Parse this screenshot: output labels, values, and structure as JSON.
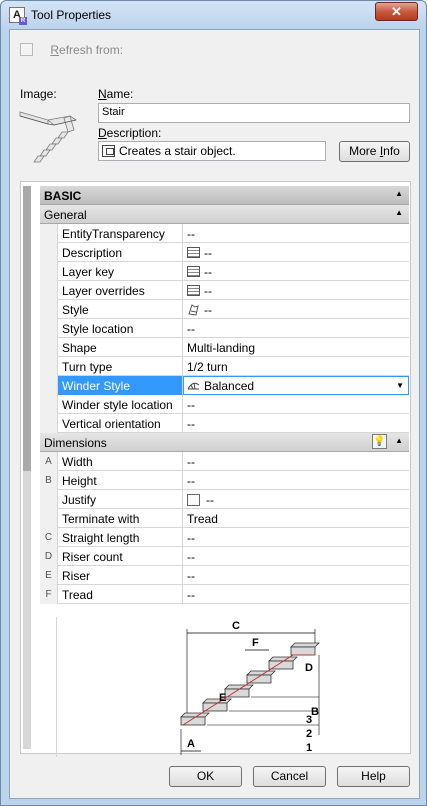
{
  "window": {
    "title": "Tool Properties",
    "close_label": "✕"
  },
  "header": {
    "refresh_label_prefix": "R",
    "refresh_label_rest": "efresh from:",
    "image_label": "Image:",
    "name_label_prefix": "N",
    "name_label_rest": "ame:",
    "name_value": "Stair",
    "description_label_prefix": "D",
    "description_label_rest": "escription:",
    "description_value": "Creates a stair object.",
    "more_info_prefix": "More ",
    "more_info_underlined": "I",
    "more_info_rest": "nfo"
  },
  "grid": {
    "basic_label": "BASIC",
    "general_label": "General",
    "dimensions_label": "Dimensions",
    "general_rows": [
      {
        "name": "EntityTransparency",
        "value": "--",
        "icon": "none"
      },
      {
        "name": "Description",
        "value": "--",
        "icon": "table-icon"
      },
      {
        "name": "Layer key",
        "value": "--",
        "icon": "table-icon"
      },
      {
        "name": "Layer overrides",
        "value": "--",
        "icon": "table-icon"
      },
      {
        "name": "Style",
        "value": "--",
        "icon": "style-icon"
      },
      {
        "name": "Style location",
        "value": "--",
        "icon": "none"
      },
      {
        "name": "Shape",
        "value": "Multi-landing",
        "icon": "none"
      },
      {
        "name": "Turn type",
        "value": "1/2 turn",
        "icon": "none"
      },
      {
        "name": "Winder Style",
        "value": "Balanced",
        "icon": "winder-icon",
        "selected": true
      },
      {
        "name": "Winder style location",
        "value": "--",
        "icon": "none"
      },
      {
        "name": "Vertical orientation",
        "value": "--",
        "icon": "none"
      }
    ],
    "dimension_rows": [
      {
        "letter": "A",
        "name": "Width",
        "value": "--"
      },
      {
        "letter": "B",
        "name": "Height",
        "value": "--"
      },
      {
        "letter": "",
        "name": "Justify",
        "value": "--",
        "icon": "swatch"
      },
      {
        "letter": "",
        "name": "Terminate with",
        "value": "Tread"
      },
      {
        "letter": "C",
        "name": "Straight length",
        "value": "--"
      },
      {
        "letter": "D",
        "name": "Riser count",
        "value": "--"
      },
      {
        "letter": "E",
        "name": "Riser",
        "value": "--"
      },
      {
        "letter": "F",
        "name": "Tread",
        "value": "--"
      }
    ],
    "diagram_labels": {
      "c": "C",
      "f": "F",
      "d": "D",
      "e": "E",
      "b": "B",
      "a": "A",
      "n3": "3",
      "n2": "2",
      "n1": "1"
    }
  },
  "buttons": {
    "ok": "OK",
    "cancel": "Cancel",
    "help": "Help"
  }
}
